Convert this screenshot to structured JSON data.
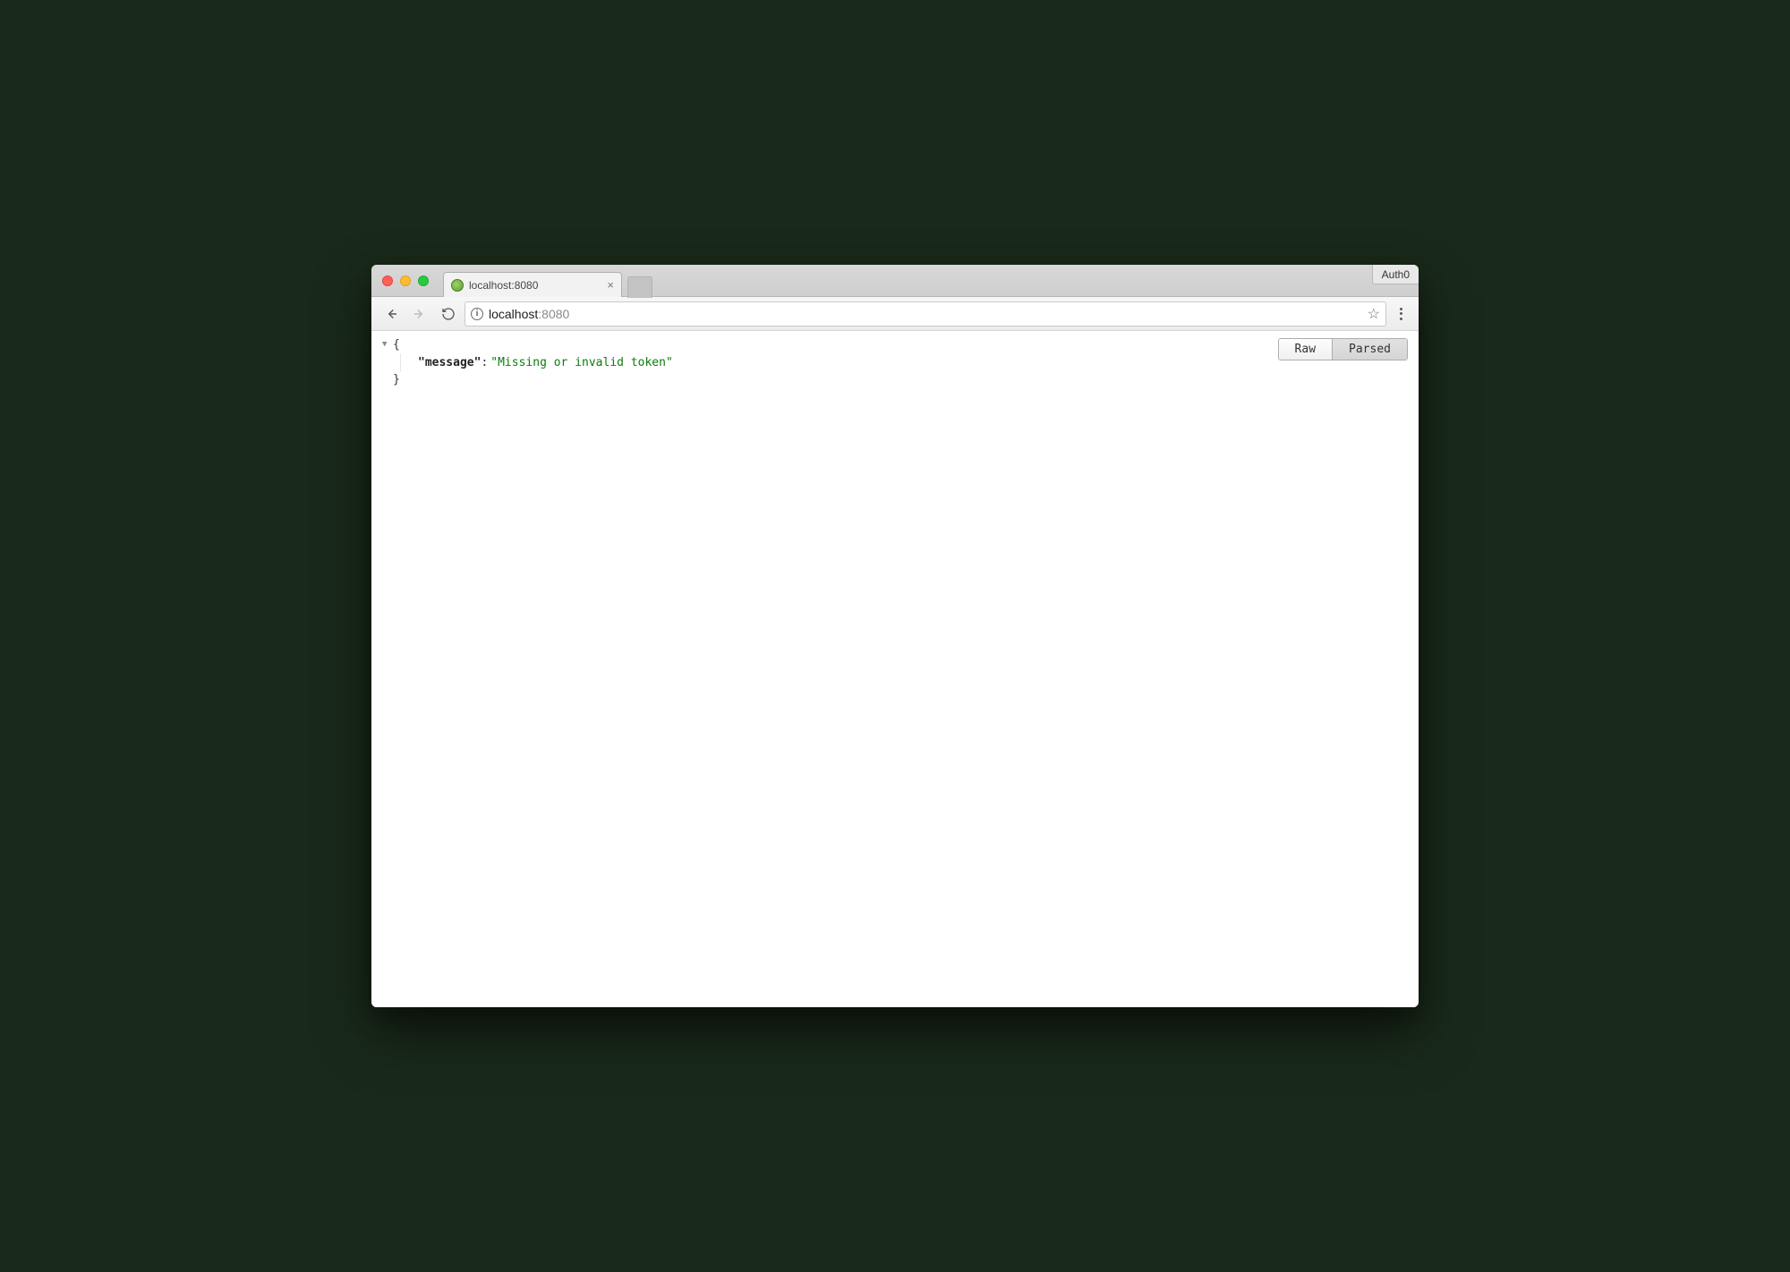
{
  "tab": {
    "title": "localhost:8080",
    "favicon_name": "localhost-favicon"
  },
  "profile_badge": "Auth0",
  "navigation": {
    "back_enabled": true,
    "forward_enabled": false
  },
  "omnibox": {
    "host": "localhost",
    "port": ":8080"
  },
  "view_toggle": {
    "raw_label": "Raw",
    "parsed_label": "Parsed",
    "active": "parsed"
  },
  "json_body": {
    "open_brace": "{",
    "close_brace": "}",
    "key_display": "\"message\"",
    "colon": ":",
    "value_display": "\"Missing or invalid token\"",
    "data": {
      "message": "Missing or invalid token"
    }
  }
}
